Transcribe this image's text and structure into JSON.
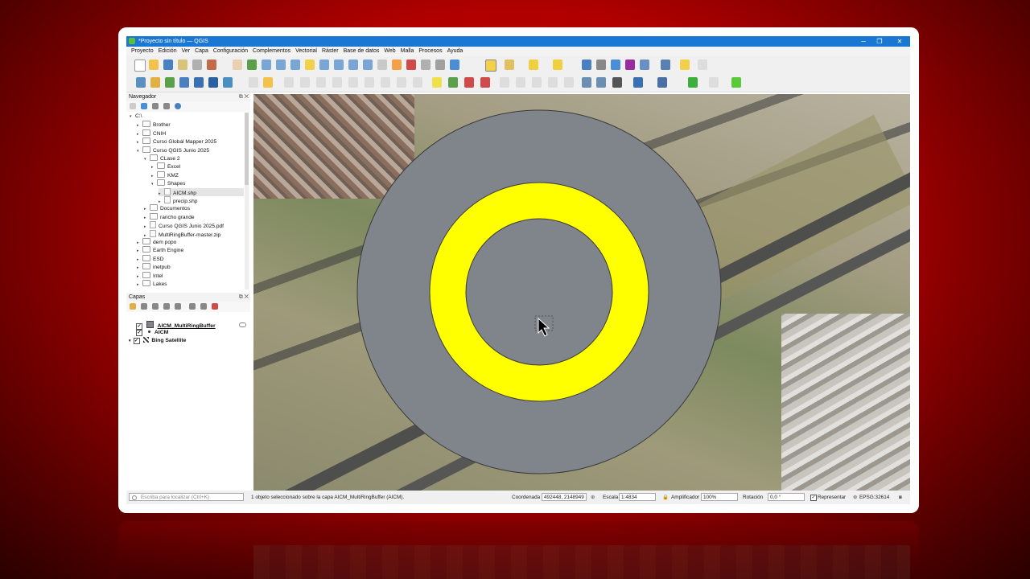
{
  "window": {
    "title": "*Proyecto sin título — QGIS",
    "controls": [
      "─",
      "❐",
      "✕"
    ]
  },
  "menu": [
    "Proyecto",
    "Edición",
    "Ver",
    "Capa",
    "Configuración",
    "Complementos",
    "Vectorial",
    "Ráster",
    "Base de datos",
    "Web",
    "Malla",
    "Procesos",
    "Ayuda"
  ],
  "navigator": {
    "title": "Navegador",
    "items": [
      {
        "label": "C:\\",
        "indent": 0,
        "arrow": "▾",
        "type": "drive"
      },
      {
        "label": "Brother",
        "indent": 1,
        "arrow": "▸",
        "type": "folder"
      },
      {
        "label": "CNIH",
        "indent": 1,
        "arrow": "▸",
        "type": "folder"
      },
      {
        "label": "Curso Global Mapper 2025",
        "indent": 1,
        "arrow": "▸",
        "type": "folder"
      },
      {
        "label": "Curso QGIS Junio 2025",
        "indent": 1,
        "arrow": "▾",
        "type": "folder"
      },
      {
        "label": "CLase 2",
        "indent": 2,
        "arrow": "▾",
        "type": "folder"
      },
      {
        "label": "Excel",
        "indent": 3,
        "arrow": "▸",
        "type": "folder"
      },
      {
        "label": "KMZ",
        "indent": 3,
        "arrow": "▸",
        "type": "folder"
      },
      {
        "label": "Shapes",
        "indent": 3,
        "arrow": "▾",
        "type": "folder"
      },
      {
        "label": "AICM.shp",
        "indent": 4,
        "arrow": "▸",
        "type": "file",
        "selected": true
      },
      {
        "label": "precip.shp",
        "indent": 4,
        "arrow": "▸",
        "type": "file"
      },
      {
        "label": "Documentos",
        "indent": 2,
        "arrow": "▸",
        "type": "folder"
      },
      {
        "label": "rancho grande",
        "indent": 2,
        "arrow": "▸",
        "type": "folder"
      },
      {
        "label": "Curso QGIS Junio 2025.pdf",
        "indent": 2,
        "arrow": "▸",
        "type": "file"
      },
      {
        "label": "MultiRingBuffer-master.zip",
        "indent": 2,
        "arrow": "▸",
        "type": "file"
      },
      {
        "label": "dem popo",
        "indent": 1,
        "arrow": "▸",
        "type": "folder"
      },
      {
        "label": "Earth Engine",
        "indent": 1,
        "arrow": "▸",
        "type": "folder"
      },
      {
        "label": "ESD",
        "indent": 1,
        "arrow": "▸",
        "type": "folder"
      },
      {
        "label": "inetpub",
        "indent": 1,
        "arrow": "▸",
        "type": "folder"
      },
      {
        "label": "Intel",
        "indent": 1,
        "arrow": "▸",
        "type": "folder"
      },
      {
        "label": "Lakes",
        "indent": 1,
        "arrow": "▸",
        "type": "folder"
      }
    ]
  },
  "layers": {
    "title": "Capas",
    "items": [
      {
        "label": "AICM_MultiRingBuffer",
        "checked": "✓",
        "underline": true
      },
      {
        "label": "AICM",
        "checked": "✓"
      },
      {
        "label": "Bing Satellite",
        "checked": "✓"
      }
    ]
  },
  "status": {
    "locator_placeholder": "Escriba para localizar (Ctrl+K)",
    "message": "1 objeto seleccionado sobre la capa AICM_MultiRingBuffer (AICM).",
    "coord_label": "Coordenada",
    "coord_value": "492448, 2148949",
    "scale_label": "Escala",
    "scale_value": "1:4834",
    "magnifier_label": "Amplificador",
    "magnifier_value": "100%",
    "rotation_label": "Rotación",
    "rotation_value": "0,0 °",
    "render_label": "Representar",
    "render_checked": "✓",
    "crs": "EPSG:32614"
  },
  "colors": {
    "outer_ring": "#7f858a",
    "middle_ring": "#ffff00",
    "inner_ring": "#7f858a"
  }
}
